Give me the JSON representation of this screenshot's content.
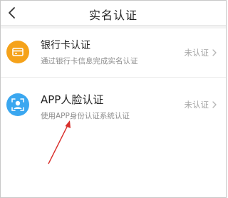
{
  "header": {
    "title": "实名认证"
  },
  "items": [
    {
      "title": "银行卡认证",
      "subtitle": "通过银行卡信息完成实名认证",
      "status": "未认证"
    },
    {
      "title": "APP人脸认证",
      "subtitle": "使用APP身份认证系统认证",
      "status": "未认证"
    }
  ],
  "colors": {
    "bank_icon": "#f5a21a",
    "face_icon": "#3aa7f0",
    "annotation_arrow": "#d9302c"
  }
}
